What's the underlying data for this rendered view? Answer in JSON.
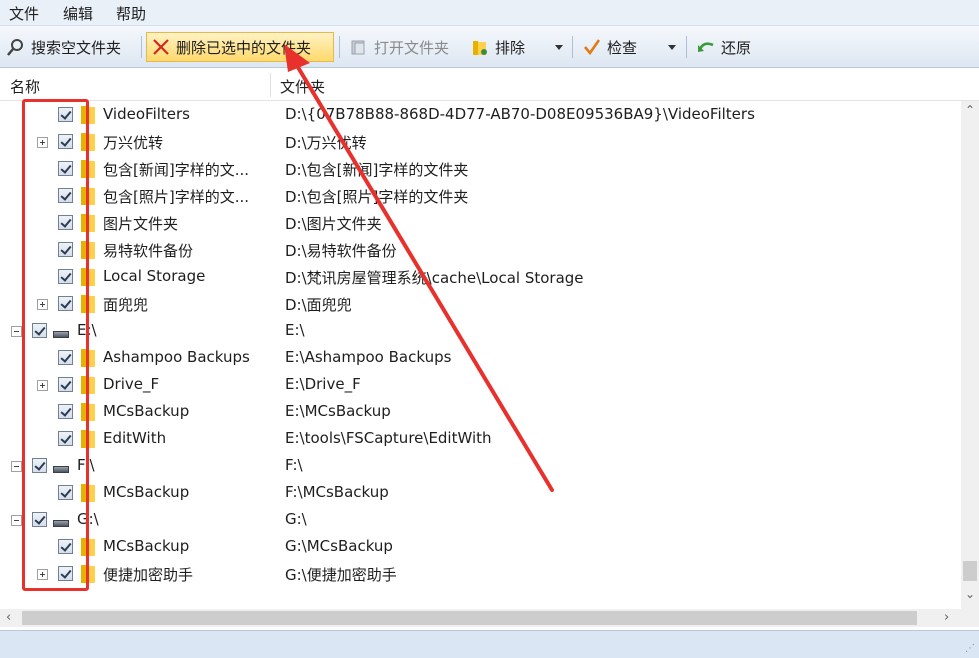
{
  "menu": [
    "文件",
    "编辑",
    "帮助"
  ],
  "toolbar": {
    "search_empty": "搜索空文件夹",
    "delete_selected": "删除已选中的文件夹",
    "open_folder": "打开文件夹",
    "exclude": "排除",
    "check": "检查",
    "restore": "还原"
  },
  "columns": {
    "name": "名称",
    "folder": "文件夹"
  },
  "rows": [
    {
      "name": "VideoFilters",
      "path": "D:\\{07B78B88-868D-4D77-AB70-D08E09536BA9}\\VideoFilters"
    },
    {
      "name": "万兴优转",
      "path": "D:\\万兴优转"
    },
    {
      "name": "包含[新闻]字样的文...",
      "path": "D:\\包含[新闻]字样的文件夹"
    },
    {
      "name": "包含[照片]字样的文...",
      "path": "D:\\包含[照片]字样的文件夹"
    },
    {
      "name": "图片文件夹",
      "path": "D:\\图片文件夹"
    },
    {
      "name": "易特软件备份",
      "path": "D:\\易特软件备份"
    },
    {
      "name": "Local Storage",
      "path": "D:\\梵讯房屋管理系统\\cache\\Local Storage"
    },
    {
      "name": "面兜兜",
      "path": "D:\\面兜兜"
    },
    {
      "name": "E:\\",
      "path": "E:\\"
    },
    {
      "name": "Ashampoo Backups",
      "path": "E:\\Ashampoo Backups"
    },
    {
      "name": "Drive_F",
      "path": "E:\\Drive_F"
    },
    {
      "name": "MCsBackup",
      "path": "E:\\MCsBackup"
    },
    {
      "name": "EditWith",
      "path": "E:\\tools\\FSCapture\\EditWith"
    },
    {
      "name": "F:\\",
      "path": "F:\\"
    },
    {
      "name": "MCsBackup",
      "path": "F:\\MCsBackup"
    },
    {
      "name": "G:\\",
      "path": "G:\\"
    },
    {
      "name": "MCsBackup",
      "path": "G:\\MCsBackup"
    },
    {
      "name": "便捷加密助手",
      "path": "G:\\便捷加密助手"
    }
  ],
  "colors": {
    "annotation": "#e8302c",
    "folder": "#ffd04a",
    "status_bar": "#dae6f4"
  }
}
